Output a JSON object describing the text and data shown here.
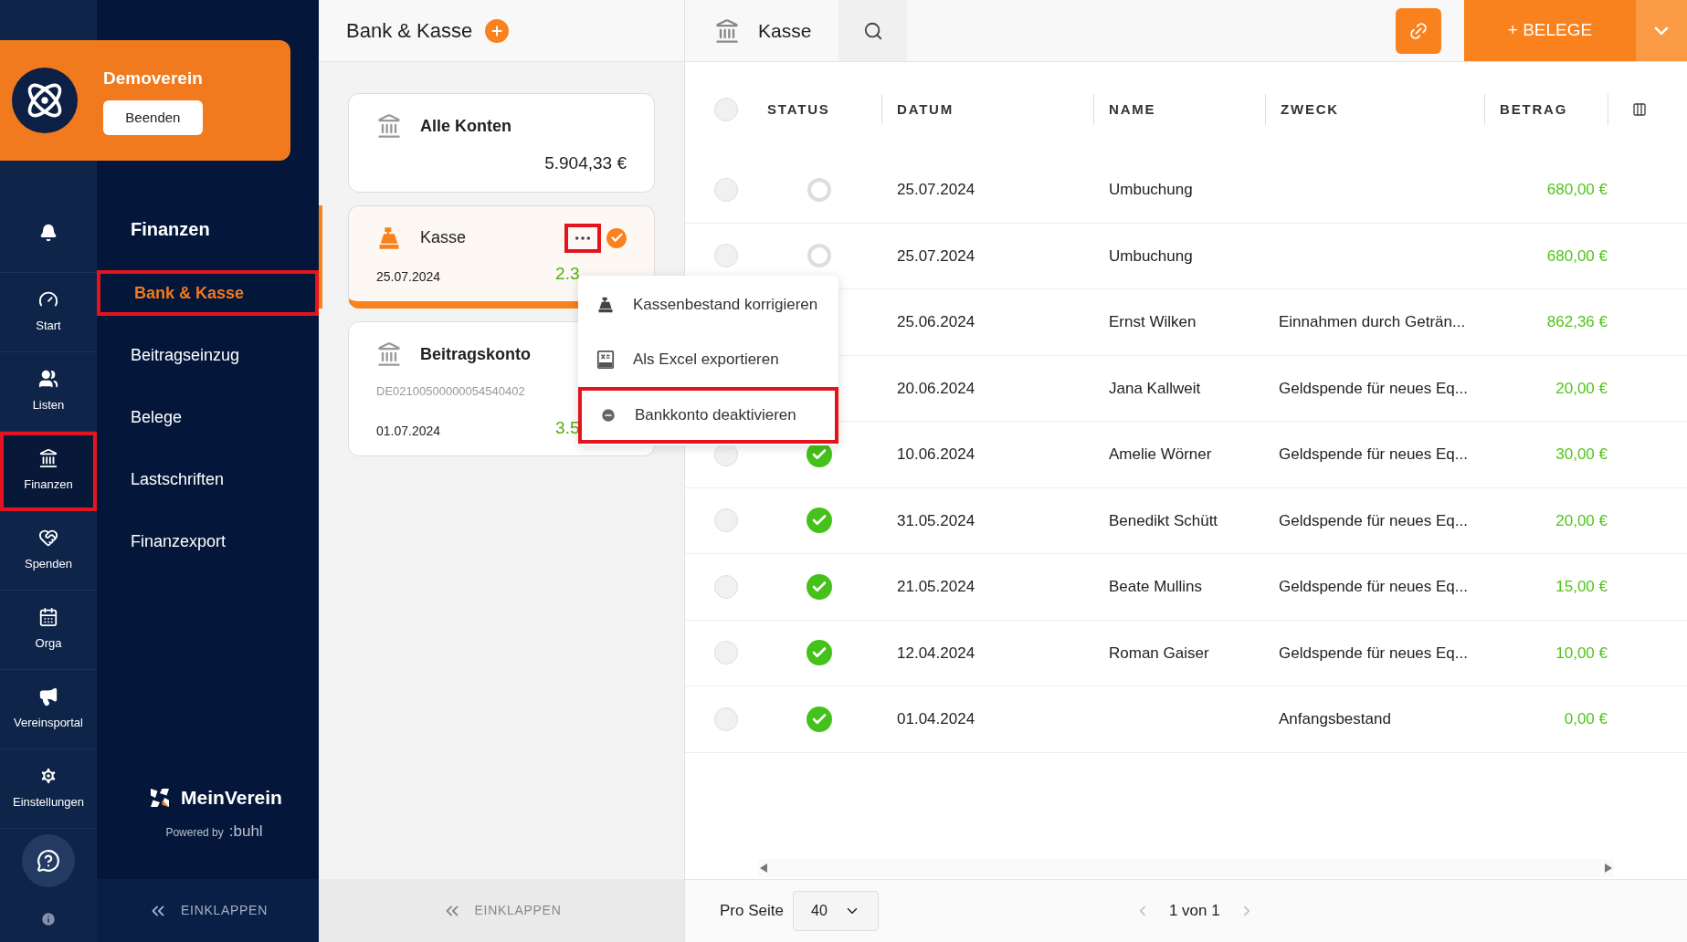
{
  "org": {
    "name": "Demoverein",
    "button": "Beenden"
  },
  "rail": [
    {
      "kind": "bell",
      "selected": false,
      "highlighted": false
    },
    {
      "kind": "start",
      "label": "Start",
      "selected": false,
      "highlighted": false
    },
    {
      "kind": "listen",
      "label": "Listen",
      "selected": false,
      "highlighted": false
    },
    {
      "kind": "finanzen",
      "label": "Finanzen",
      "selected": true,
      "highlighted": true
    },
    {
      "kind": "spenden",
      "label": "Spenden",
      "selected": false,
      "highlighted": false
    },
    {
      "kind": "orga",
      "label": "Orga",
      "selected": false,
      "highlighted": false
    },
    {
      "kind": "portal",
      "label": "Vereinsportal",
      "selected": false,
      "highlighted": false
    },
    {
      "kind": "settings",
      "label": "Einstellungen",
      "selected": false,
      "highlighted": false
    }
  ],
  "subnav": {
    "title": "Finanzen",
    "items": [
      {
        "label": "Bank & Kasse",
        "selected": true,
        "highlighted": true
      },
      {
        "label": "Beitragseinzug",
        "selected": false,
        "highlighted": false
      },
      {
        "label": "Belege",
        "selected": false,
        "highlighted": false
      },
      {
        "label": "Lastschriften",
        "selected": false,
        "highlighted": false
      },
      {
        "label": "Finanzexport",
        "selected": false,
        "highlighted": false
      }
    ],
    "brand": "MeinVerein",
    "powered": "Powered by",
    "maker": ":buhl",
    "collapse": "EINKLAPPEN"
  },
  "accounts": {
    "title": "Bank & Kasse",
    "cards": [
      {
        "kind": "all",
        "name": "Alle Konten",
        "amount": "5.904,33 €",
        "selected": false
      },
      {
        "kind": "cash",
        "name": "Kasse",
        "date": "25.07.2024",
        "amount": "2.3",
        "selected": true,
        "menu_highlighted": true
      },
      {
        "kind": "bank",
        "name": "Beitragskonto",
        "iban": "DE02100500000054540402",
        "date": "01.07.2024",
        "amount": "3.5",
        "selected": false
      }
    ],
    "collapse": "EINKLAPPEN"
  },
  "menu": {
    "items": [
      {
        "kind": "cash",
        "label": "Kassenbestand korrigieren",
        "highlighted": false
      },
      {
        "kind": "excel",
        "label": "Als Excel exportieren",
        "highlighted": false
      },
      {
        "kind": "deactivate",
        "label": "Bankkonto deaktivieren",
        "highlighted": true
      }
    ]
  },
  "ledger": {
    "title": "Kasse",
    "add": "+ BELEGE",
    "all_selected": false,
    "columns": [
      "STATUS",
      "DATUM",
      "NAME",
      "ZWECK",
      "BETRAG"
    ],
    "rows": [
      {
        "selected": false,
        "approved": false,
        "date": "25.07.2024",
        "name": "Umbuchung",
        "amount": "680,00 €"
      },
      {
        "selected": false,
        "approved": false,
        "date": "25.07.2024",
        "name": "Umbuchung",
        "amount": "680,00 €"
      },
      {
        "date": "25.06.2024",
        "name": "Ernst Wilken",
        "purpose": "Einnahmen durch Geträn...",
        "amount": "862,36 €"
      },
      {
        "date": "20.06.2024",
        "name": "Jana Kallweit",
        "purpose": "Geldspende für neues Eq...",
        "amount": "20,00 €"
      },
      {
        "selected": false,
        "approved": true,
        "date": "10.06.2024",
        "name": "Amelie Wörner",
        "purpose": "Geldspende für neues Eq...",
        "amount": "30,00 €"
      },
      {
        "selected": false,
        "approved": true,
        "date": "31.05.2024",
        "name": "Benedikt Schütt",
        "purpose": "Geldspende für neues Eq...",
        "amount": "20,00 €"
      },
      {
        "selected": false,
        "approved": true,
        "date": "21.05.2024",
        "name": "Beate Mullins",
        "purpose": "Geldspende für neues Eq...",
        "amount": "15,00 €"
      },
      {
        "selected": false,
        "approved": true,
        "date": "12.04.2024",
        "name": "Roman Gaiser",
        "purpose": "Geldspende für neues Eq...",
        "amount": "10,00 €"
      },
      {
        "selected": false,
        "approved": true,
        "date": "01.04.2024",
        "purpose": "Anfangsbestand",
        "amount": "0,00 €"
      }
    ],
    "per_page_label": "Pro Seite",
    "per_page": "40",
    "page": "1 von 1"
  }
}
